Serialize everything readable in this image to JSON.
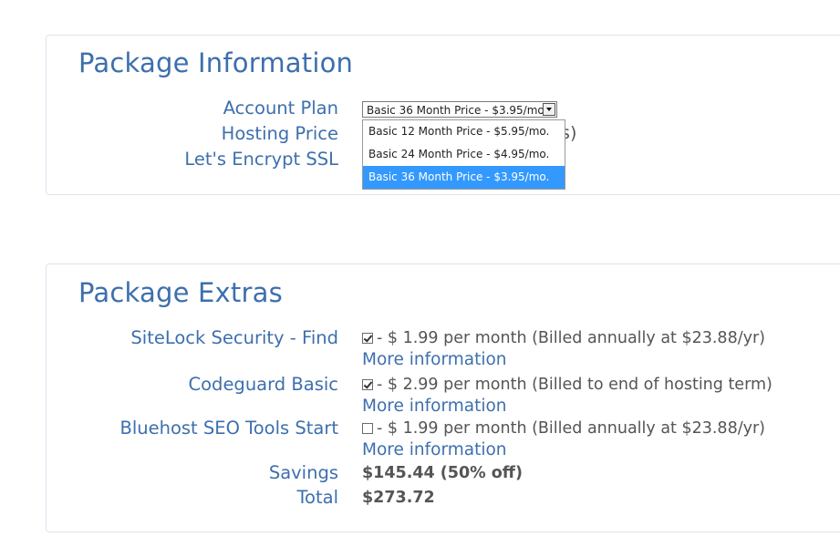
{
  "package_information": {
    "title": "Package Information",
    "account_plan_label": "Account Plan",
    "hosting_price_label": "Hosting Price",
    "ssl_label": "Let's Encrypt SSL",
    "selected_plan": "Basic 36 Month Price - $3.95/mo.",
    "plan_options": [
      "Basic 12 Month Price - $5.95/mo.",
      "Basic 24 Month Price - $4.95/mo.",
      "Basic 36 Month Price - $3.95/mo."
    ],
    "hosting_price_partial": "hs)"
  },
  "package_extras": {
    "title": "Package Extras",
    "items": [
      {
        "label": "SiteLock Security - Find",
        "checked": true,
        "price_text": "- $ 1.99 per month (Billed annually at $23.88/yr)",
        "more_link": "More information"
      },
      {
        "label": "Codeguard Basic",
        "checked": true,
        "price_text": "- $ 2.99 per month (Billed to end of hosting term)",
        "more_link": "More information"
      },
      {
        "label": "Bluehost SEO Tools Start",
        "checked": false,
        "price_text": "- $ 1.99 per month (Billed annually at $23.88/yr)",
        "more_link": "More information"
      }
    ],
    "savings_label": "Savings",
    "savings_value": "$145.44 (50% off)",
    "total_label": "Total",
    "total_value": "$273.72"
  },
  "colors": {
    "heading_blue": "#3d6fad",
    "body_gray": "#555555",
    "selected_option_bg": "#3399ff",
    "panel_border": "#dbe5ee"
  }
}
